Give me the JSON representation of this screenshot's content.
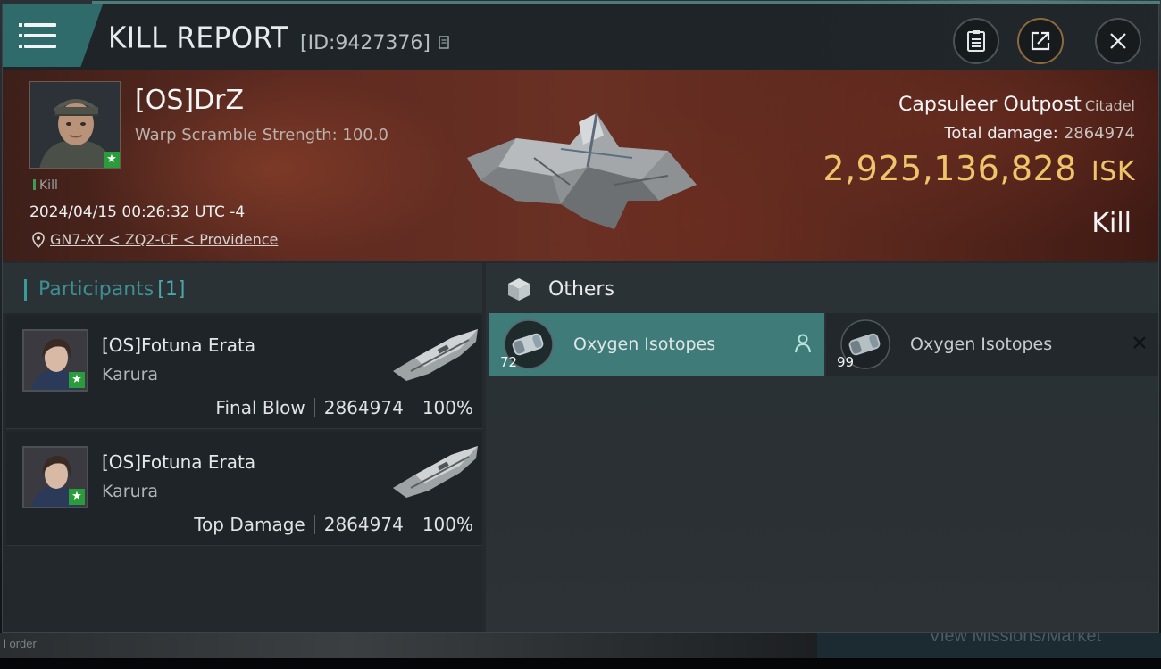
{
  "header": {
    "title": "KILL REPORT",
    "report_id": "[ID:9427376]"
  },
  "victim": {
    "name": "[OS]DrZ",
    "detail": "Warp Scramble Strength: 100.0",
    "tag": "Kill",
    "time": "2024/04/15 00:26:32 UTC -4",
    "location": "GN7-XY < ZQ2-CF < Providence"
  },
  "target": {
    "name": "Capsuleer Outpost",
    "class": "Citadel",
    "total_damage_label": "Total damage:",
    "total_damage": "2864974",
    "isk_value": "2,925,136,828",
    "isk_unit": "ISK",
    "result": "Kill"
  },
  "participants": {
    "label": "Participants",
    "count": "[1]",
    "rows": [
      {
        "name": "[OS]Fotuna Erata",
        "ship": "Karura",
        "role": "Final Blow",
        "damage": "2864974",
        "percent": "100%"
      },
      {
        "name": "[OS]Fotuna Erata",
        "ship": "Karura",
        "role": "Top Damage",
        "damage": "2864974",
        "percent": "100%"
      }
    ]
  },
  "others": {
    "label": "Others",
    "items": [
      {
        "name": "Oxygen Isotopes",
        "qty": "72",
        "status": "owned"
      },
      {
        "name": "Oxygen Isotopes",
        "qty": "99",
        "status": "destroyed"
      }
    ]
  },
  "background": {
    "left_text": "l order",
    "right_text": "View Missions/Market"
  },
  "colors": {
    "accent_teal": "#3f7c79",
    "isk_gold": "#f0c46a",
    "badge_green": "#2a9c3c"
  }
}
